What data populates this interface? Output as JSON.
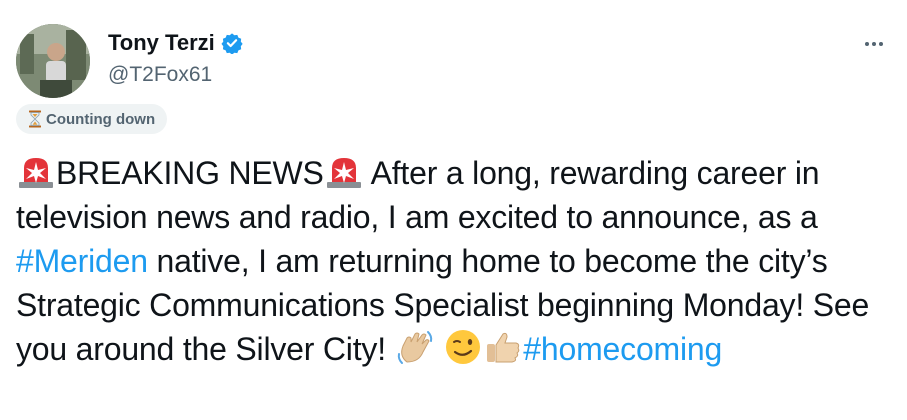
{
  "author": {
    "display_name": "Tony Terzi",
    "handle": "@T2Fox61",
    "verified": true
  },
  "status": {
    "icon": "hourglass-icon",
    "label": "Counting down"
  },
  "tweet": {
    "segments": [
      {
        "kind": "emoji",
        "icon": "siren-icon"
      },
      {
        "kind": "text",
        "text": "BREAKING NEWS"
      },
      {
        "kind": "emoji",
        "icon": "siren-icon"
      },
      {
        "kind": "text",
        "text": " After a long, rewarding career in television news and radio, I am excited to announce, as a "
      },
      {
        "kind": "hashtag",
        "text": "#Meriden"
      },
      {
        "kind": "text",
        "text": " native, I am returning home to become the city’s Strategic Communications Specialist beginning Monday! See you around the Silver City! "
      },
      {
        "kind": "emoji",
        "icon": "waving-hand-icon"
      },
      {
        "kind": "text",
        "text": " "
      },
      {
        "kind": "emoji",
        "icon": "winking-face-icon"
      },
      {
        "kind": "emoji",
        "icon": "thumbs-up-icon"
      },
      {
        "kind": "hashtag",
        "text": "#homecoming"
      }
    ]
  },
  "colors": {
    "link": "#1d9bf0",
    "secondary_text": "#536471",
    "verified": "#1d9bf0"
  }
}
